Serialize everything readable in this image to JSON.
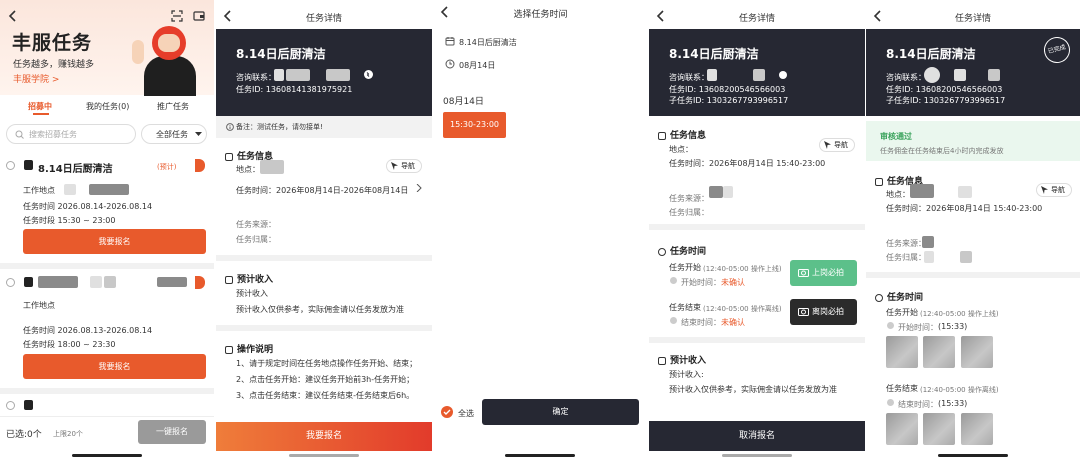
{
  "colors": {
    "accent": "#e85a2c",
    "dark_header": "#262833",
    "green": "#5cc08a",
    "dark_button": "#2b2b2b"
  },
  "icons": {
    "back": "chevron-left-icon",
    "scan": "scan-icon",
    "wallet": "wallet-icon",
    "navigate": "navigation-arrow-icon",
    "calendar": "calendar-icon",
    "clock": "clock-icon",
    "camera": "camera-icon",
    "search": "search-icon",
    "completed_stamp": "completed-stamp-icon"
  },
  "p1": {
    "brand_title": "丰服任务",
    "slogan": "任务越多，赚钱越多",
    "academy_link": "丰服学院 >",
    "tabs": [
      {
        "label": "招募中"
      },
      {
        "label": "我的任务(0)"
      },
      {
        "label": "推广任务"
      }
    ],
    "search_placeholder": "搜索招募任务",
    "filter_label": "全部任务",
    "task1": {
      "title": "8.14日后厨清洁",
      "estimate": "(预计)",
      "loc_label": "工作地点",
      "date": "任务时间  2026.08.14-2026.08.14",
      "period": "任务时段  15:30 ~ 23:00",
      "apply_label": "我要报名"
    },
    "task2": {
      "loc_label": "工作地点",
      "date": "任务时间  2026.08.13-2026.08.14",
      "period": "任务时段  18:00 ~ 23:30",
      "apply_label": "我要报名"
    },
    "footer": {
      "selected": "已选:0个",
      "limit": "上限20个",
      "batch_label": "一键报名"
    }
  },
  "p2": {
    "nav_title": "任务详情",
    "task_title": "8.14日后厨清洁",
    "contact_label": "咨询联系：",
    "task_id": "任务ID: 13608141381975921",
    "note": "备注：测试任务，请勿接单!",
    "info_title": "任务信息",
    "location_label": "地点：",
    "nav_label": "导航",
    "time_text": "任务时间：2026年08月14日-2026年08月14日",
    "source_label": "任务来源：",
    "owner_label": "任务归属：",
    "income_title": "预计收入",
    "income_sub": "预计收入",
    "income_note": "预计收入仅供参考，实际佣金请以任务发放为准",
    "ops_title": "操作说明",
    "ops": [
      "1、请于规定时间在任务地点操作任务开始、结束；",
      "2、点击任务开始：建议任务开始前3h-任务开始；",
      "3、点击任务结束：建议任务结束-任务结束后6h。"
    ],
    "apply_label": "我要报名"
  },
  "p3": {
    "nav_title": "选择任务时间",
    "task_name": "8.14日后厨清洁",
    "date": "08月14日",
    "date_heading": "08月14日",
    "slot": "15:30-23:00",
    "select_all": "全选",
    "confirm": "确定"
  },
  "p4": {
    "nav_title": "任务详情",
    "task_title": "8.14日后厨清洁",
    "contact_label": "咨询联系：",
    "task_id": "任务ID: 13608200546566003",
    "subtask_id": "子任务ID: 1303267793996517",
    "info_title": "任务信息",
    "location_label": "地点：",
    "nav_label": "导航",
    "time_text": "任务时间：2026年08月14日 15:40-23:00",
    "source_label": "任务来源：",
    "owner_label": "任务归属：",
    "time_title": "任务时间",
    "start_label": "任务开始",
    "start_note": "(12:40-05:00 操作上线)",
    "start_time_label": "开始时间：",
    "start_status": "未确认",
    "start_btn": "上岗必拍",
    "end_label": "任务结束",
    "end_note": "(12:40-05:00 操作离线)",
    "end_time_label": "结束时间：",
    "end_status": "未确认",
    "end_btn": "离岗必拍",
    "income_title": "预计收入",
    "income_sub": "预计收入:",
    "income_note": "预计收入仅供参考，实际佣金请以任务发放为准",
    "cancel_label": "取消报名"
  },
  "p5": {
    "nav_title": "任务详情",
    "task_title": "8.14日后厨清洁",
    "stamp": "已完成",
    "contact_label": "咨询联系：",
    "task_id": "任务ID: 13608200546566003",
    "subtask_id": "子任务ID: 1303267793996517",
    "approved": "审核通过",
    "approved_note": "任务佣金在任务结束后4小时内完成发放",
    "info_title": "任务信息",
    "location_label": "地点：",
    "nav_label": "导航",
    "time_text": "任务时间：2026年08月14日 15:40-23:00",
    "source_label": "任务来源：",
    "owner_label": "任务归属：",
    "time_title": "任务时间",
    "start_label": "任务开始",
    "start_note": "(12:40-05:00 操作上线)",
    "start_time_label": "开始时间：",
    "start_time": "(15:33)",
    "end_label": "任务结束",
    "end_note": "(12:40-05:00 操作离线)",
    "end_time_label": "结束时间：",
    "end_time": "(15:33)"
  }
}
